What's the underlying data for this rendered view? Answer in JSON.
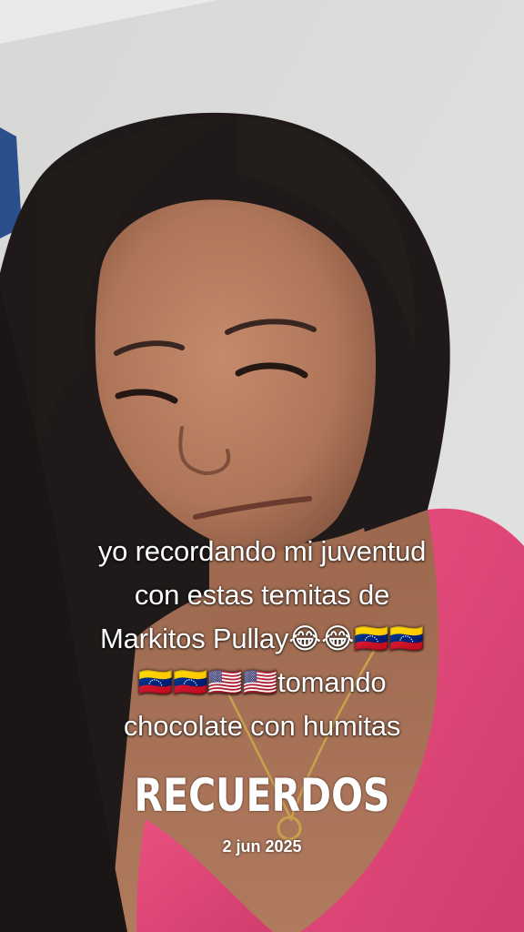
{
  "overlay": {
    "caption_lines": [
      "yo recordando mi juventud",
      "con estas temitas de",
      "Markitos Pullay😂😂🇻🇪🇻🇪",
      "🇻🇪🇻🇪🇺🇸🇺🇸tomando",
      "chocolate con humitas"
    ],
    "title": "RECUERDOS",
    "date": "2 jun 2025"
  },
  "colors": {
    "wall": "#dcdcda",
    "hair": "#1e1a19",
    "skin": "#b77f63",
    "shirt": "#e2467a",
    "text": "#ffffff"
  }
}
